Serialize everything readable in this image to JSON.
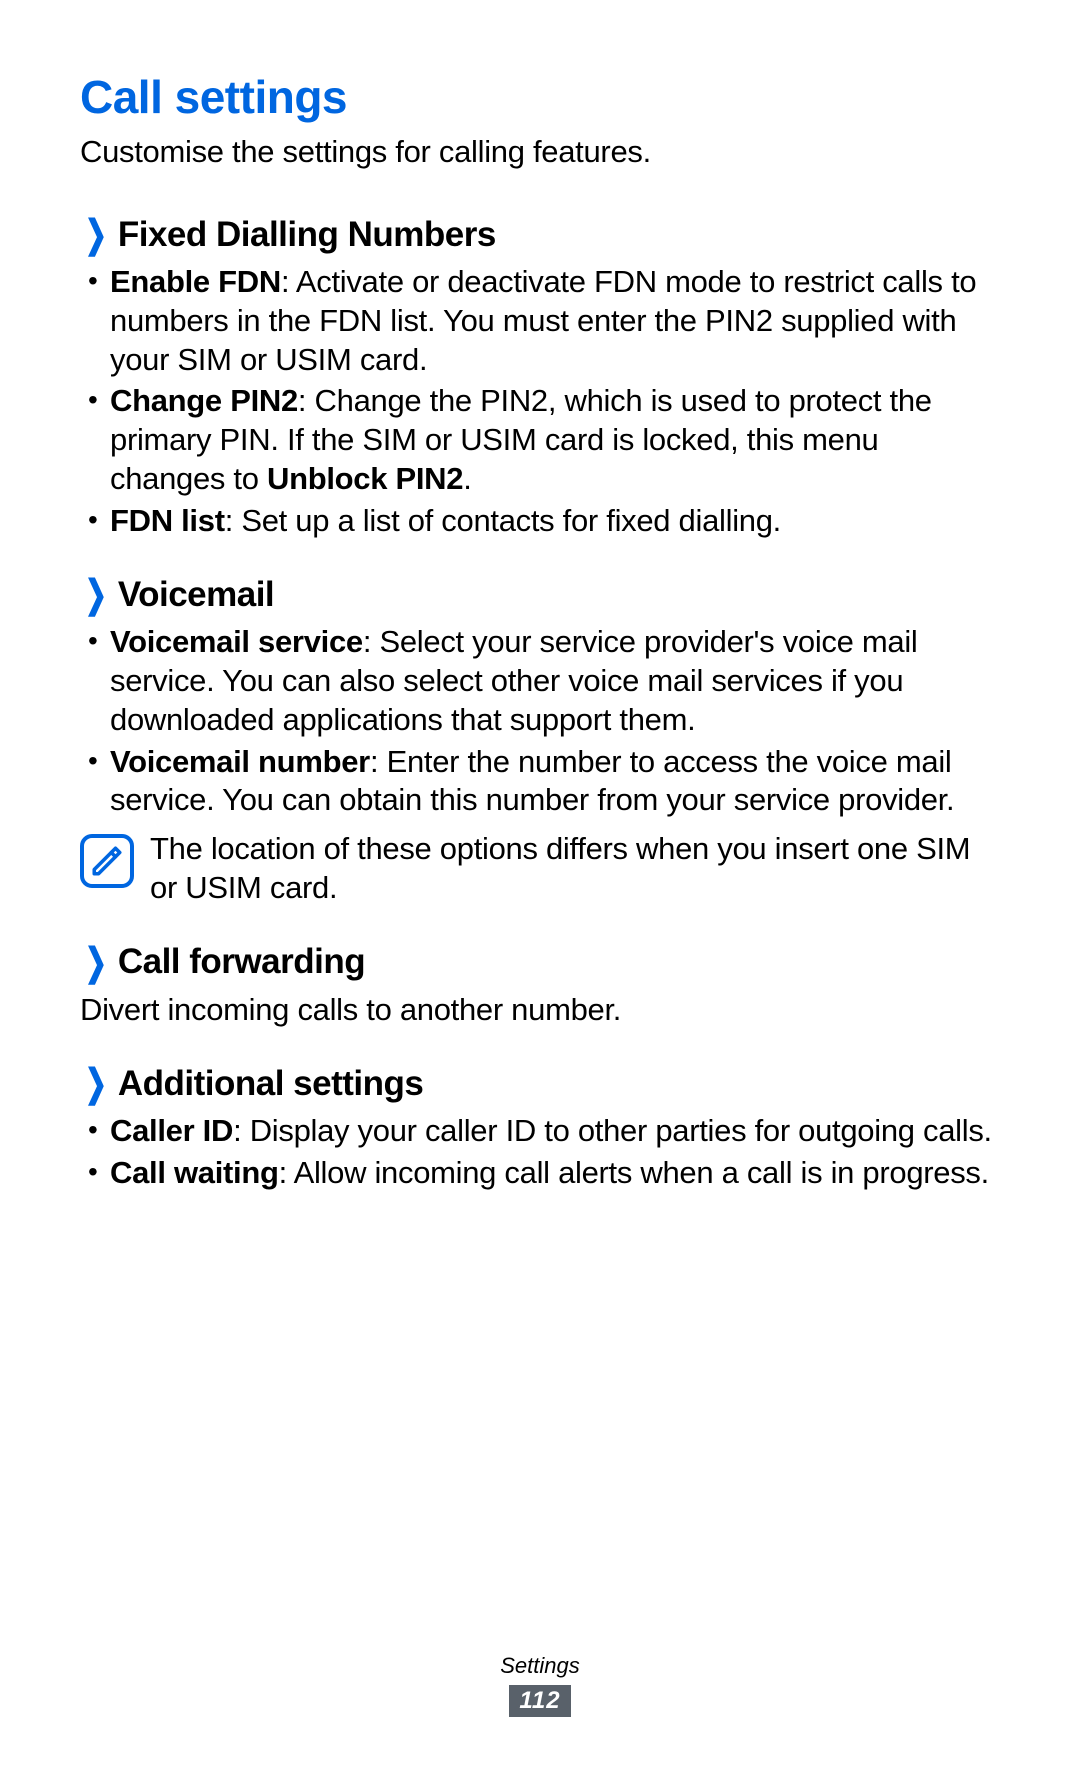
{
  "page": {
    "title": "Call settings",
    "subtitle": "Customise the settings for calling features."
  },
  "sections": {
    "fdn": {
      "title": "Fixed Dialling Numbers",
      "items": [
        {
          "bold": "Enable FDN",
          "rest": ": Activate or deactivate FDN mode to restrict calls to numbers in the FDN list. You must enter the PIN2 supplied with your SIM or USIM card."
        },
        {
          "bold": "Change PIN2",
          "rest_pre": ": Change the PIN2, which is used to protect the primary PIN. If the SIM or USIM card is locked, this menu changes to ",
          "bold2": "Unblock PIN2",
          "rest_post": "."
        },
        {
          "bold": "FDN list",
          "rest": ": Set up a list of contacts for fixed dialling."
        }
      ]
    },
    "voicemail": {
      "title": "Voicemail",
      "items": [
        {
          "bold": "Voicemail service",
          "rest": ": Select your service provider's voice mail service. You can also select other voice mail services if you downloaded applications that support them."
        },
        {
          "bold": "Voicemail number",
          "rest": ": Enter the number to access the voice mail service. You can obtain this number from your service provider."
        }
      ],
      "note": "The location of these options differs when you insert one SIM or USIM card."
    },
    "forwarding": {
      "title": "Call forwarding",
      "desc": "Divert incoming calls to another number."
    },
    "additional": {
      "title": "Additional settings",
      "items": [
        {
          "bold": "Caller ID",
          "rest": ": Display your caller ID to other parties for outgoing calls."
        },
        {
          "bold": "Call waiting",
          "rest": ": Allow incoming call alerts when a call is in progress."
        }
      ]
    }
  },
  "footer": {
    "label": "Settings",
    "page": "112"
  }
}
